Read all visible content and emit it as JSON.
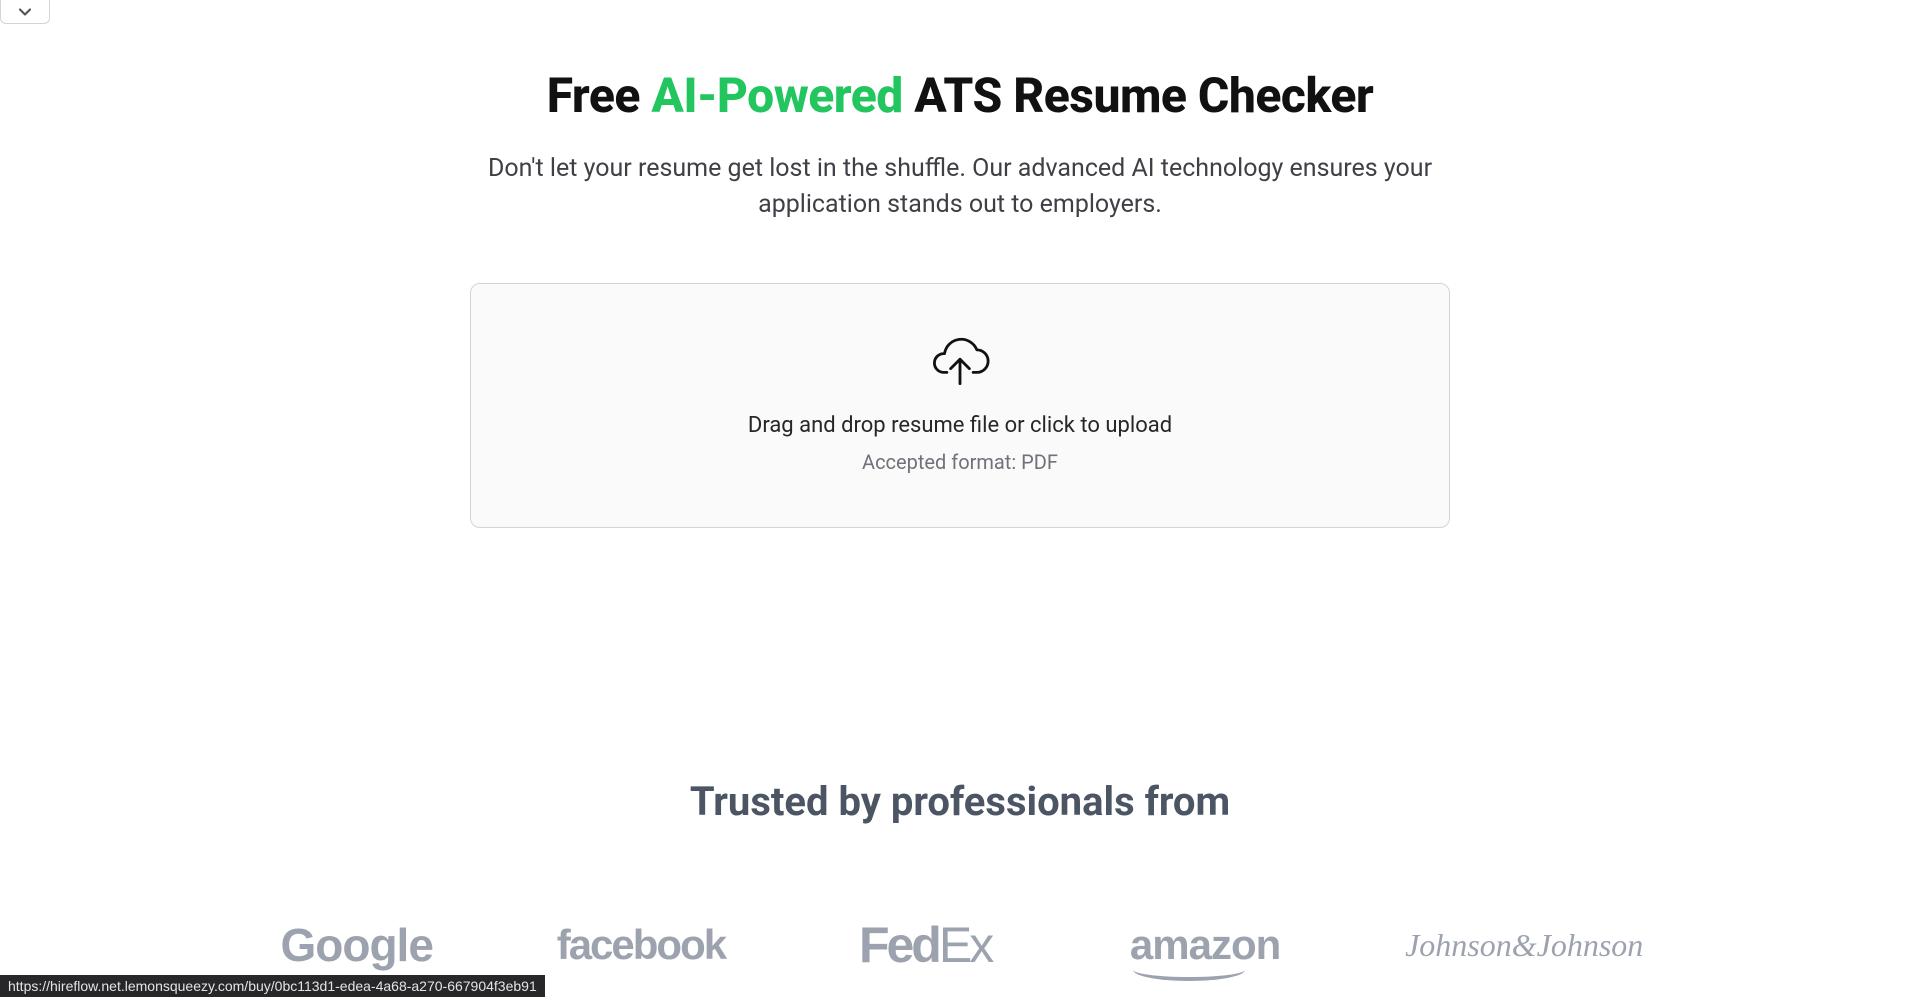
{
  "hero": {
    "title_pre": "Free ",
    "title_accent": "AI-Powered",
    "title_post": " ATS Resume Checker",
    "subtitle": "Don't let your resume get lost in the shuffle. Our advanced AI technology ensures your application stands out to employers."
  },
  "dropzone": {
    "main_text": "Drag and drop resume file or click to upload",
    "sub_text": "Accepted format: PDF"
  },
  "trusted": {
    "heading": "Trusted by professionals from",
    "logos": {
      "google": "Google",
      "facebook": "facebook",
      "fedex_fed": "Fed",
      "fedex_ex": "Ex",
      "amazon": "amazon",
      "jnj": "Johnson&Johnson"
    }
  },
  "status": {
    "text": "https://hireflow.net.lemonsqueezy.com/buy/0bc113d1-edea-4a68-a270-667904f3eb91"
  }
}
